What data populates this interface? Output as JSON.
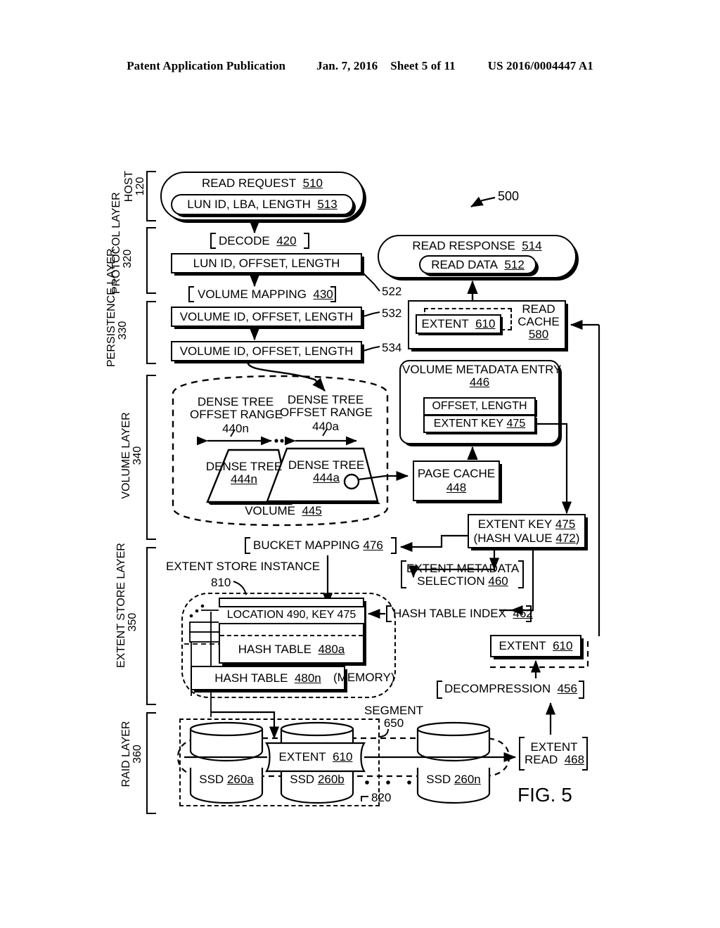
{
  "header": {
    "publication": "Patent Application Publication",
    "date": "Jan. 7, 2016",
    "sheet": "Sheet 5 of 11",
    "patent_number": "US 2016/0004447 A1"
  },
  "figure": {
    "label": "FIG. 5",
    "diagram_ref": "500"
  },
  "layers": [
    {
      "name": "HOST",
      "ref": "120"
    },
    {
      "name": "PROTOCOL LAYER",
      "ref": "320"
    },
    {
      "name": "PERSISTENCE LAYER",
      "ref": "330"
    },
    {
      "name": "VOLUME LAYER",
      "ref": "340"
    },
    {
      "name": "EXTENT STORE LAYER",
      "ref": "350"
    },
    {
      "name": "RAID LAYER",
      "ref": "360"
    }
  ],
  "host": {
    "read_request": {
      "label": "READ REQUEST",
      "ref": "510"
    },
    "lun_id_lba_length": {
      "label": "LUN ID, LBA, LENGTH",
      "ref": "513"
    }
  },
  "protocol": {
    "decode": {
      "label": "DECODE",
      "ref": "420"
    },
    "lun_id_offset_length": {
      "label": "LUN ID, OFFSET, LENGTH",
      "ref": "522"
    },
    "volume_mapping": {
      "label": "VOLUME MAPPING",
      "ref": "430"
    }
  },
  "persistence": {
    "volume_id_offset_length_1": {
      "label": "VOLUME ID, OFFSET, LENGTH",
      "ref": "532"
    },
    "volume_id_offset_length_2": {
      "label": "VOLUME ID, OFFSET, LENGTH",
      "ref": "534"
    }
  },
  "response": {
    "read_response": {
      "label": "READ RESPONSE",
      "ref": "514"
    },
    "read_data": {
      "label": "READ DATA",
      "ref": "512"
    }
  },
  "read_cache": {
    "title_line1": "READ",
    "title_line2": "CACHE",
    "ref": "580",
    "extent": {
      "label": "EXTENT",
      "ref": "610"
    }
  },
  "volume_metadata_entry": {
    "title": "VOLUME METADATA ENTRY",
    "ref": "446",
    "offset_length": "OFFSET, LENGTH",
    "extent_key": {
      "label": "EXTENT KEY",
      "ref": "475"
    }
  },
  "volume_layer": {
    "offset_range_n": {
      "line1": "DENSE TREE",
      "line2": "OFFSET RANGE",
      "ref": "440n"
    },
    "offset_range_a": {
      "line1": "DENSE TREE",
      "line2": "OFFSET RANGE",
      "ref": "440a"
    },
    "dense_tree_n": {
      "label": "DENSE TREE",
      "ref": "444n"
    },
    "dense_tree_a": {
      "label": "DENSE TREE",
      "ref": "444a"
    },
    "volume": {
      "label": "VOLUME",
      "ref": "445"
    },
    "page_cache": {
      "label": "PAGE CACHE",
      "ref": "448"
    }
  },
  "extent_key_box": {
    "line1_label": "EXTENT KEY",
    "line1_ref": "475",
    "line2_label": "(HASH VALUE",
    "line2_ref": "472",
    "line2_tail": ")"
  },
  "extent_store": {
    "bucket_mapping": {
      "label": "BUCKET MAPPING",
      "ref": "476"
    },
    "instance": {
      "label": "EXTENT STORE INSTANCE",
      "ref": "810"
    },
    "extent_metadata_selection": {
      "line1": "EXTENT METADATA",
      "line2": "SELECTION",
      "ref": "460"
    },
    "hash_table_index": {
      "label": "HASH TABLE INDEX",
      "ref": "462"
    },
    "location_key_row": "LOCATION 490, KEY 475",
    "hash_table_a": {
      "label": "HASH TABLE",
      "ref": "480a"
    },
    "hash_table_n": {
      "label": "HASH TABLE",
      "ref": "480n"
    },
    "memory": "(MEMORY)",
    "extent": {
      "label": "EXTENT",
      "ref": "610"
    },
    "decompression": {
      "label": "DECOMPRESSION",
      "ref": "456"
    }
  },
  "raid": {
    "segment": {
      "label": "SEGMENT",
      "ref": "650"
    },
    "extent": {
      "label": "EXTENT",
      "ref": "610"
    },
    "ssds": [
      {
        "label": "SSD",
        "ref": "260a"
      },
      {
        "label": "SSD",
        "ref": "260b"
      },
      {
        "label": "SSD",
        "ref": "260n"
      }
    ],
    "array_ref": "820",
    "extent_read": {
      "line1": "EXTENT",
      "line2": "READ",
      "ref": "468"
    }
  },
  "colors": {
    "ink": "#000000",
    "paper": "#ffffff"
  }
}
